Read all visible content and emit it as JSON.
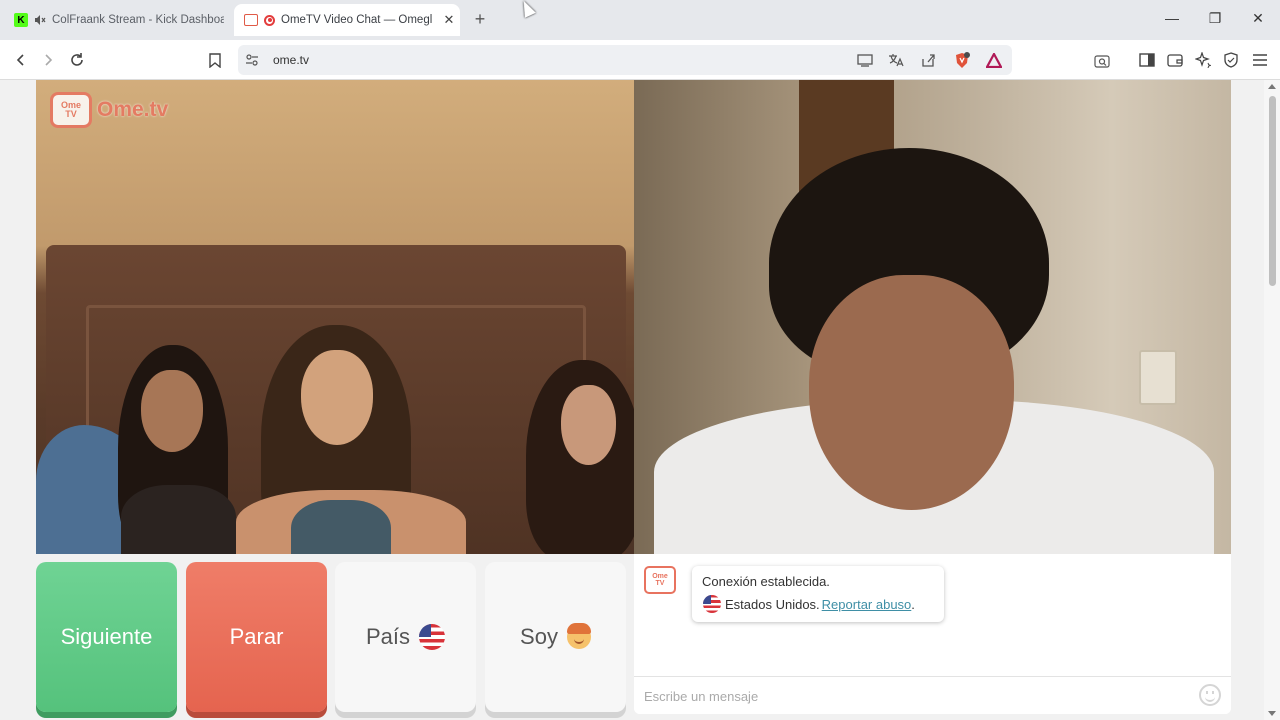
{
  "browser": {
    "tabs": [
      {
        "title": "ColFraank Stream - Kick Dashboa",
        "favicon": "K",
        "muted": true,
        "active": false
      },
      {
        "title": "OmeTV Video Chat — Omegl",
        "active": true
      }
    ],
    "new_tab_label": "+",
    "window_controls": {
      "minimize": "—",
      "restore": "❐",
      "close": "✕"
    },
    "url": "ome.tv"
  },
  "page": {
    "logo": {
      "badge_top": "Ome",
      "badge_bottom": "TV",
      "text": "Ome.tv"
    },
    "buttons": {
      "next": "Siguiente",
      "stop": "Parar",
      "country": "País",
      "gender": "Soy"
    },
    "chat": {
      "logo_top": "Ome",
      "logo_bottom": "TV",
      "status": "Conexión establecida.",
      "country": "Estados Unidos.",
      "report_link": "Reportar abuso",
      "report_suffix": ".",
      "input_placeholder": "Escribe un mensaje"
    }
  },
  "colors": {
    "next": "#55c27c",
    "stop": "#e5644f",
    "brand": "#e8735f",
    "link": "#3f8fa6"
  }
}
